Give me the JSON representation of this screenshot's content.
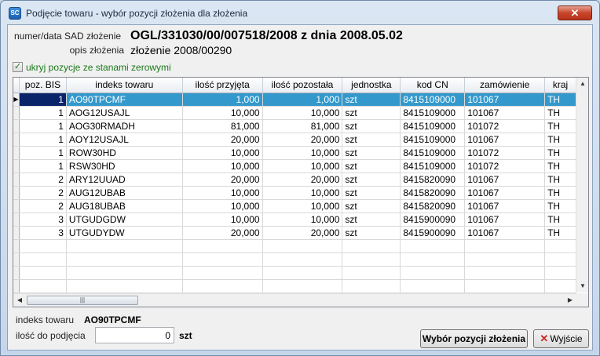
{
  "window": {
    "title": "Podjęcie towaru - wybór pozycji złożenia dla złożenia",
    "app_icon_text": "SC",
    "close_symbol": "✕"
  },
  "info": {
    "sad_label": "numer/data SAD złożenie",
    "sad_value": "OGL/331030/00/007518/2008 z dnia 2008.05.02",
    "opis_label": "opis złożenia",
    "opis_value": "złożenie 2008/00290"
  },
  "filter": {
    "checked": true,
    "label": "ukryj pozycje ze stanami zerowymi"
  },
  "table": {
    "columns": [
      "poz. BIS",
      "indeks towaru",
      "ilość przyjęta",
      "ilość pozostała",
      "jednostka",
      "kod CN",
      "zamówienie",
      "kraj"
    ],
    "rows": [
      [
        "1",
        "AO90TPCMF",
        "1,000",
        "1,000",
        "szt",
        "8415109000",
        "101067",
        "TH"
      ],
      [
        "1",
        "AOG12USAJL",
        "10,000",
        "10,000",
        "szt",
        "8415109000",
        "101067",
        "TH"
      ],
      [
        "1",
        "AOG30RMADH",
        "81,000",
        "81,000",
        "szt",
        "8415109000",
        "101072",
        "TH"
      ],
      [
        "1",
        "AOY12USAJL",
        "20,000",
        "20,000",
        "szt",
        "8415109000",
        "101067",
        "TH"
      ],
      [
        "1",
        "ROW30HD",
        "10,000",
        "10,000",
        "szt",
        "8415109000",
        "101072",
        "TH"
      ],
      [
        "1",
        "RSW30HD",
        "10,000",
        "10,000",
        "szt",
        "8415109000",
        "101072",
        "TH"
      ],
      [
        "2",
        "ARY12UUAD",
        "20,000",
        "20,000",
        "szt",
        "8415820090",
        "101067",
        "TH"
      ],
      [
        "2",
        "AUG12UBAB",
        "10,000",
        "10,000",
        "szt",
        "8415820090",
        "101067",
        "TH"
      ],
      [
        "2",
        "AUG18UBAB",
        "10,000",
        "10,000",
        "szt",
        "8415820090",
        "101067",
        "TH"
      ],
      [
        "3",
        "UTGUDGDW",
        "10,000",
        "10,000",
        "szt",
        "8415900090",
        "101067",
        "TH"
      ],
      [
        "3",
        "UTGUDYDW",
        "20,000",
        "20,000",
        "szt",
        "8415900090",
        "101067",
        "TH"
      ]
    ],
    "selected_row": 0,
    "empty_rows": 4
  },
  "footer": {
    "indeks_label": "indeks towaru",
    "indeks_value": "AO90TPCMF",
    "qty_label": "ilość do podjęcia",
    "qty_value": "0",
    "unit": "szt",
    "select_button": "Wybór pozycji złożenia",
    "exit_button": "Wyjście"
  },
  "colors": {
    "selection": "#3399cc",
    "selection_first_cell": "#0a246a",
    "checkbox_label": "#1a7a1a",
    "exit_icon": "#c8281e"
  }
}
